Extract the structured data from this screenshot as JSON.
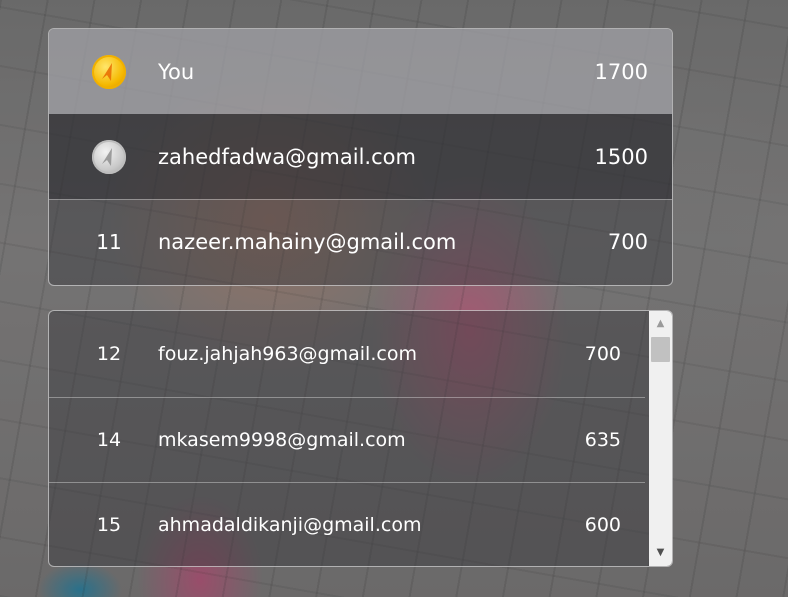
{
  "top_ranks": [
    {
      "medal": "gold-medal-icon",
      "rank": "",
      "name": "You",
      "score": "1700"
    },
    {
      "medal": "silver-medal-icon",
      "rank": "",
      "name": "zahedfadwa@gmail.com",
      "score": "1500"
    },
    {
      "medal": "",
      "rank": "11",
      "name": "nazeer.mahainy@gmail.com",
      "score": "700"
    }
  ],
  "list": [
    {
      "rank": "12",
      "name": "fouz.jahjah963@gmail.com",
      "score": "700"
    },
    {
      "rank": "14",
      "name": "mkasem9998@gmail.com",
      "score": "635"
    },
    {
      "rank": "15",
      "name": "ahmadaldikanji@gmail.com",
      "score": "600"
    }
  ],
  "scrollbar": {
    "up_icon": "▲",
    "down_icon": "▼"
  },
  "colors": {
    "gold": "#f5b800",
    "silver": "#c8c8c8"
  }
}
